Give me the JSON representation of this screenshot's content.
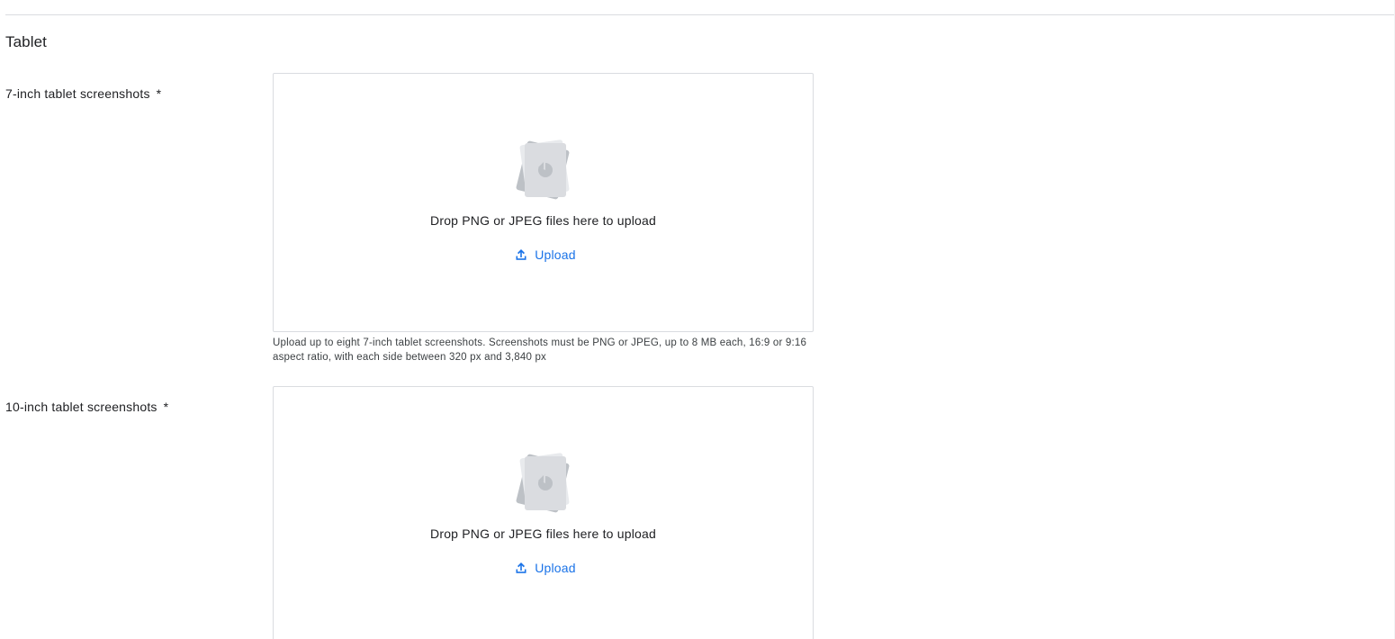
{
  "section": {
    "title": "Tablet"
  },
  "fields": [
    {
      "label": "7-inch tablet screenshots",
      "required_mark": "*",
      "dropzone": {
        "drop_text": "Drop PNG or JPEG files here to upload",
        "upload_label": "Upload",
        "icon": "image-stack-icon",
        "upload_icon": "upload-icon"
      },
      "helper_text": "Upload up to eight 7-inch tablet screenshots. Screenshots must be PNG or JPEG, up to 8 MB each, 16:9 or 9:16 aspect ratio, with each side between 320 px and 3,840 px"
    },
    {
      "label": "10-inch tablet screenshots",
      "required_mark": "*",
      "dropzone": {
        "drop_text": "Drop PNG or JPEG files here to upload",
        "upload_label": "Upload",
        "icon": "image-stack-icon",
        "upload_icon": "upload-icon"
      }
    }
  ],
  "colors": {
    "link": "#1a73e8",
    "border": "#dadce0",
    "text": "#202124",
    "icon_grey": "#dadce0"
  }
}
